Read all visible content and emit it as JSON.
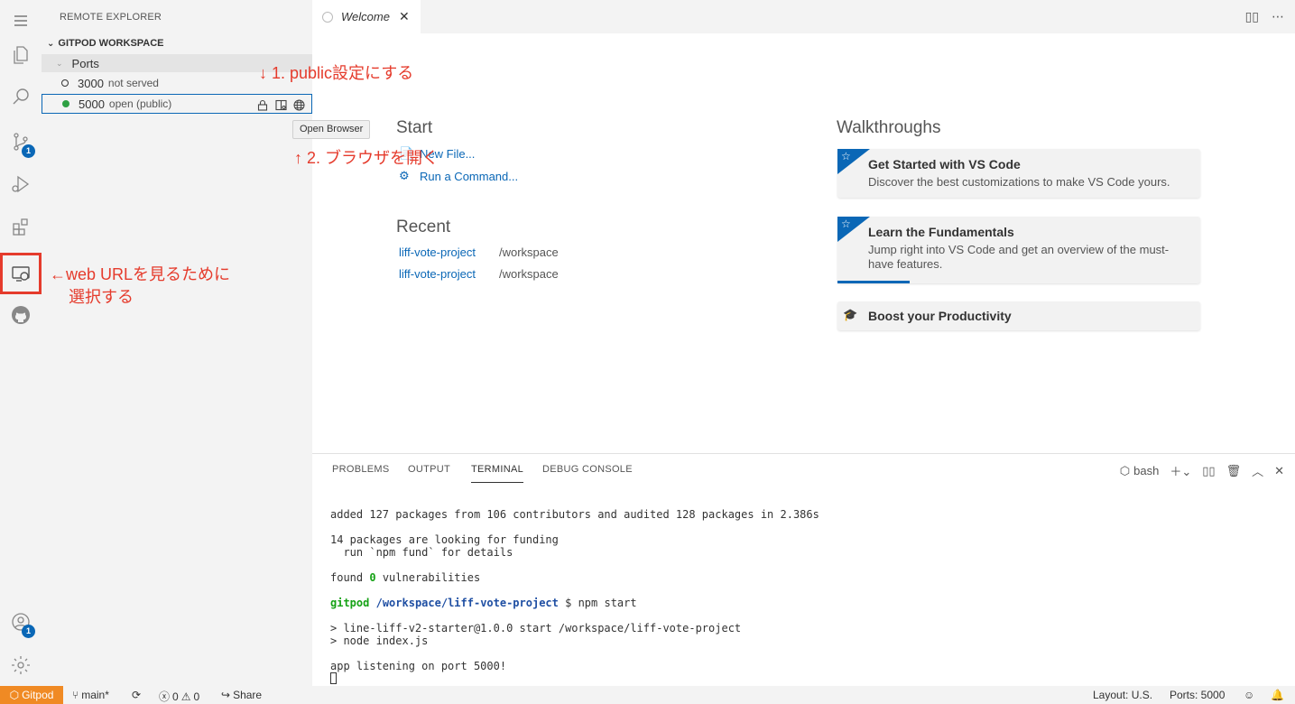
{
  "sidebar": {
    "title": "REMOTE EXPLORER",
    "section": "GITPOD WORKSPACE",
    "group": "Ports",
    "ports": [
      {
        "port": "3000",
        "status": "not served",
        "color": "#ffffff"
      },
      {
        "port": "5000",
        "status": "open (public)",
        "color": "#2ea043"
      }
    ]
  },
  "activity": {
    "badges": {
      "source_control": "1",
      "accounts": "1"
    }
  },
  "tabs": {
    "welcome": "Welcome"
  },
  "welcome": {
    "start_heading": "Start",
    "new_file": "New File...",
    "run_command": "Run a Command...",
    "recent_heading": "Recent",
    "recent": [
      {
        "name": "liff-vote-project",
        "path": "/workspace"
      },
      {
        "name": "liff-vote-project",
        "path": "/workspace"
      }
    ],
    "walkthroughs_heading": "Walkthroughs",
    "cards": [
      {
        "title": "Get Started with VS Code",
        "desc": "Discover the best customizations to make VS Code yours."
      },
      {
        "title": "Learn the Fundamentals",
        "desc": "Jump right into VS Code and get an overview of the must-have features.",
        "progress": 0.2
      },
      {
        "title": "Boost your Productivity",
        "desc": ""
      }
    ]
  },
  "tooltip": "Open Browser",
  "annotations": {
    "step1": "↓ 1. public設定にする",
    "step2": "↑ 2. ブラウザを開く",
    "select_line1": "←web URLを見るために",
    "select_line2": "選択する"
  },
  "panel": {
    "tabs": [
      "PROBLEMS",
      "OUTPUT",
      "TERMINAL",
      "DEBUG CONSOLE"
    ],
    "shell": "bash",
    "terminal": {
      "l1": "added 127 packages from 106 contributors and audited 128 packages in 2.386s",
      "l2": "14 packages are looking for funding",
      "l3": "  run `npm fund` for details",
      "l4a": "found ",
      "l4b": "0",
      "l4c": " vulnerabilities",
      "prompt_user": "gitpod",
      "prompt_path": "/workspace/liff-vote-project",
      "prompt_cmd": " $ npm start",
      "l6": "> line-liff-v2-starter@1.0.0 start /workspace/liff-vote-project",
      "l7": "> node index.js",
      "l8": "app listening on port 5000!"
    }
  },
  "statusbar": {
    "gitpod": "Gitpod",
    "branch": "main*",
    "errors": "0",
    "warnings": "0",
    "share": "Share",
    "layout": "Layout: U.S.",
    "ports": "Ports: 5000"
  },
  "colors": {
    "accent": "#0a67b6",
    "annotation": "#e53b2c",
    "gitpod": "#f08a24"
  }
}
